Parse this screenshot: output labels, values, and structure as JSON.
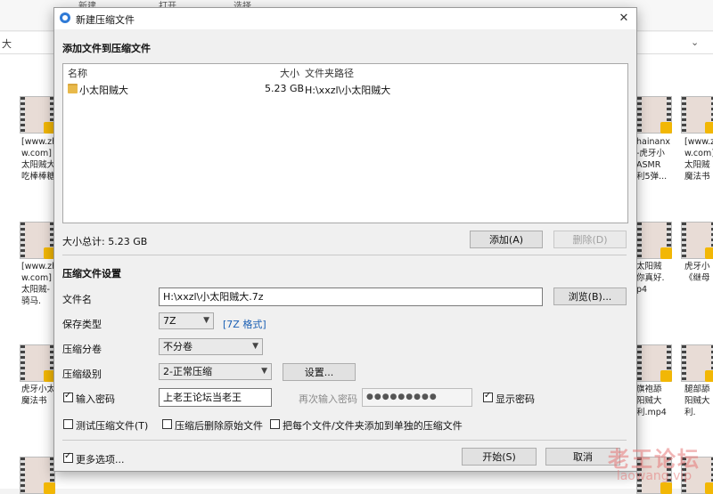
{
  "background": {
    "toolbar_labels": [
      "新建",
      "打开",
      "选择"
    ],
    "path_text": "大",
    "file_names": [
      [
        "[www.zh",
        "w.com]",
        "太阳贼大",
        "吃棒棒糖"
      ],
      [
        "hainanx",
        "-虎牙小",
        "ASMR",
        "利5弹..."
      ],
      [
        "[www.z",
        "w.com]",
        "太阳贼",
        "魔法书"
      ],
      [
        "[www.zh",
        "w.com]",
        "太阳贼-",
        "骑马."
      ],
      [
        "太阳贼",
        "你真好.",
        "p4"
      ],
      [
        "虎牙小",
        "《继母"
      ],
      [
        "虎牙小太",
        "魔法书"
      ],
      [
        "旗袍舔",
        "阳贼大",
        "利.mp4"
      ],
      [
        "腿部舔",
        "阳贼大",
        "利."
      ]
    ]
  },
  "dialog": {
    "title": "新建压缩文件",
    "close_glyph": "✕",
    "add_section_title": "添加文件到压缩文件",
    "list": {
      "headers": {
        "name": "名称",
        "size": "大小",
        "path": "文件夹路径"
      },
      "rows": [
        {
          "name": "小太阳贼大",
          "size": "5.23 GB",
          "path": "H:\\xxzl\\小太阳贼大"
        }
      ]
    },
    "total_size": "大小总计: 5.23 GB",
    "add_button": "添加(A)",
    "delete_button": "删除(D)",
    "settings_title": "压缩文件设置",
    "file_name_label": "文件名",
    "file_name_value": "H:\\xxzl\\小太阳贼大.7z",
    "browse_button": "浏览(B)...",
    "save_type_label": "保存类型",
    "save_type_value": "7Z",
    "format_link": "[7Z 格式]",
    "split_label": "压缩分卷",
    "split_value": "不分卷",
    "level_label": "压缩级别",
    "level_value": "2-正常压缩",
    "settings_button": "设置...",
    "password_label": "输入密码",
    "password_value": "上老王论坛当老王",
    "reenter_label": "再次输入密码",
    "reenter_value": "●●●●●●●●●",
    "show_password_label": "显示密码",
    "test_label": "测试压缩文件(T)",
    "delete_after_label": "压缩后删除原始文件",
    "separate_label": "把每个文件/文件夹添加到单独的压缩文件",
    "more_options_label": "更多选项...",
    "start_button": "开始(S)",
    "cancel_button": "取消"
  },
  "watermark": {
    "cn": "老王论坛",
    "en": "laowang.vip"
  },
  "colors": {
    "accent_link": "#1a5fb4",
    "folder": "#e8b94a",
    "app_icon": "#2f7ad6"
  }
}
